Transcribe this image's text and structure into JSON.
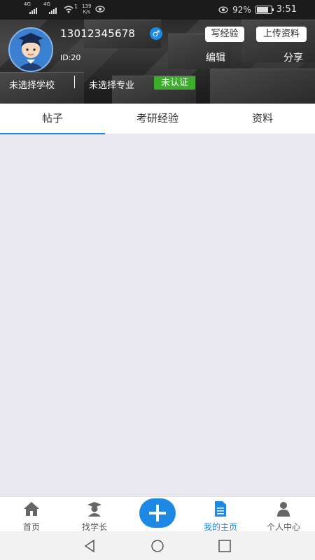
{
  "status_bar": {
    "network_1": "4G",
    "network_2": "4G",
    "wifi_tag": "1",
    "speed_value": "139",
    "speed_unit": "K/s",
    "battery": "92%",
    "battery_level": 0.92,
    "time": "3:51"
  },
  "profile": {
    "phone": "13012345678",
    "gender_symbol": "♂",
    "user_id": "ID:20",
    "write_exp_label": "写经验",
    "upload_label": "上传资料",
    "edit_label": "编辑",
    "share_label": "分享",
    "school": "未选择学校",
    "major": "未选择专业",
    "verify_status": "未认证"
  },
  "tabs": [
    {
      "label": "帖子",
      "active": true
    },
    {
      "label": "考研经验",
      "active": false
    },
    {
      "label": "资料",
      "active": false
    }
  ],
  "bottom_nav": [
    {
      "label": "首页",
      "icon": "home-icon",
      "active": false
    },
    {
      "label": "找学长",
      "icon": "graduate-icon",
      "active": false
    },
    {
      "label": "我的主页",
      "icon": "document-icon",
      "active": true
    },
    {
      "label": "个人中心",
      "icon": "person-icon",
      "active": false
    }
  ],
  "fab_icon": "plus-icon",
  "colors": {
    "accent": "#1e88e5",
    "verify_badge": "#3dae2b",
    "content_bg": "#e8e8ee"
  },
  "android_nav": {
    "back_icon": "back-triangle-icon",
    "home_icon": "home-circle-icon",
    "recent_icon": "recent-square-icon"
  }
}
